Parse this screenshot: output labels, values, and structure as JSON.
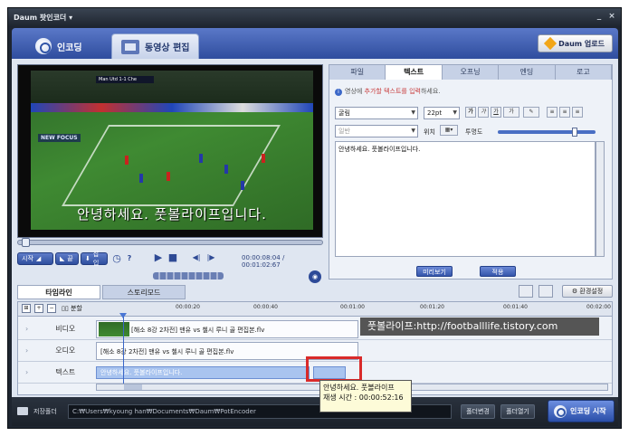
{
  "app": {
    "title": "Daum 팟인코더",
    "title_arrow": "▾",
    "minimize": "_",
    "close": "×"
  },
  "header": {
    "tab_encode": "인코딩",
    "tab_edit": "동영상 편집",
    "update_btn": "Daum 업로드"
  },
  "preview": {
    "caption": "안녕하세요. 풋볼라이프입니다.",
    "scoreboard": "Man Utd 1-1 Che",
    "adboard": "NEW FOCUS"
  },
  "player": {
    "start_btn": "시작",
    "end_btn": "끝",
    "insert_btn": "삽입",
    "help": "?",
    "time_current": "00:00:08:04",
    "time_sep": "/",
    "time_total": "00:01:02:67"
  },
  "right_panel": {
    "tabs": [
      "파일",
      "텍스트",
      "오프닝",
      "엔딩",
      "로고"
    ],
    "active_tab": "텍스트",
    "hint_prefix": "영상에 ",
    "hint_red": "추가할 텍스트를 입력",
    "hint_suffix": "하세요.",
    "font": "굴림",
    "size": "22pt",
    "fmt_bold": "가",
    "fmt_italic": "가",
    "fmt_under": "가",
    "fmt_color": "가",
    "style": "일반",
    "position_label": "위치",
    "opacity_label": "투명도",
    "opacity_value": 0.82,
    "text_value": "안녕하세요. 풋볼라이프입니다.",
    "preview_btn": "미리보기",
    "apply_btn": "적용"
  },
  "timeline": {
    "tabs": [
      "타임라인",
      "스토리모드"
    ],
    "active_tab": "타임라인",
    "settings_btn": "환경설정",
    "split_btn": "분할",
    "ticks": [
      "00:00:20",
      "00:00:40",
      "00:01:00",
      "00:01:20",
      "00:01:40",
      "00:02:00"
    ],
    "tracks": [
      {
        "label": "비디오",
        "clip": "[해소 8강 2차전] 맨유 vs 첼시 루니 골 편집본.flv"
      },
      {
        "label": "오디오",
        "clip": "[해소 8강 2차전] 맨유 vs 첼시 루니 골 편집본.flv"
      },
      {
        "label": "텍스트",
        "clip": "안녕하세요. 풋볼라이프입니다."
      }
    ]
  },
  "watermark": "풋볼라이프:http://footballlife.tistory.com",
  "tooltip": {
    "line1": "안녕하세요. 풋볼라이프",
    "line2": "재생 시간 : 00:00:52:16"
  },
  "bottom": {
    "save_label": "저장폴더",
    "path": "C:₩Users₩kyoung han₩Documents₩Daum₩PotEncoder",
    "change_btn": "폴더변경",
    "open_btn": "폴더열기",
    "start_btn": "인코딩 시작"
  }
}
